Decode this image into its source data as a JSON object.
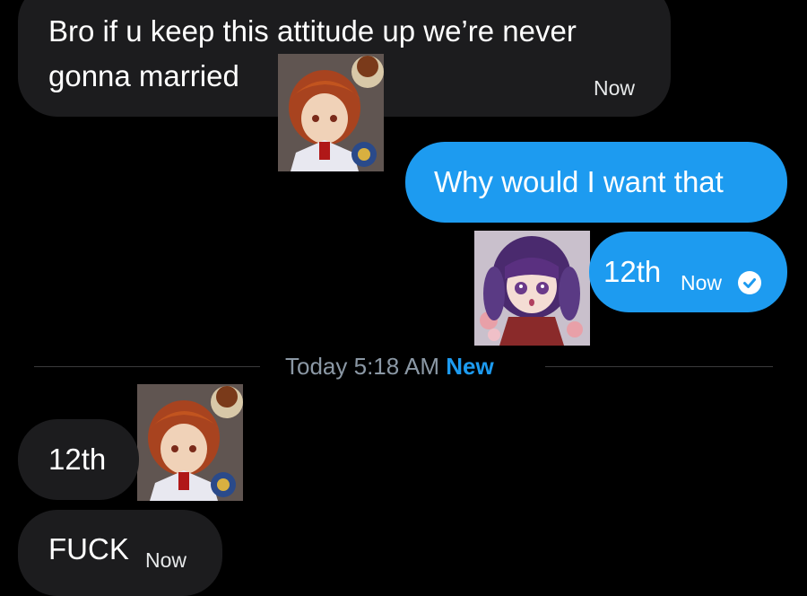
{
  "messages": [
    {
      "direction": "incoming",
      "lines": [
        "Bro if u keep this attitude up we’re never",
        "gonna married"
      ],
      "time": "Now"
    },
    {
      "direction": "outgoing",
      "text": "Why would I want that"
    },
    {
      "direction": "outgoing",
      "text": "12th",
      "time": "Now",
      "status_icon": "read-check-icon"
    },
    {
      "direction": "incoming",
      "text": "12th"
    },
    {
      "direction": "incoming",
      "text": "FUCK",
      "time": "Now"
    }
  ],
  "divider": {
    "text": "Today 5:18 AM",
    "badge": "New"
  },
  "stickers": [
    {
      "name": "red-haired-anime-boy-sticker"
    },
    {
      "name": "purple-haired-anime-girl-sticker"
    },
    {
      "name": "red-haired-anime-boy-sticker"
    }
  ],
  "colors": {
    "background": "#000000",
    "incoming_bubble": "#1c1c1e",
    "outgoing_bubble": "#1d9bf0",
    "accent": "#1d9bf0",
    "divider_text": "#8b98a5"
  }
}
